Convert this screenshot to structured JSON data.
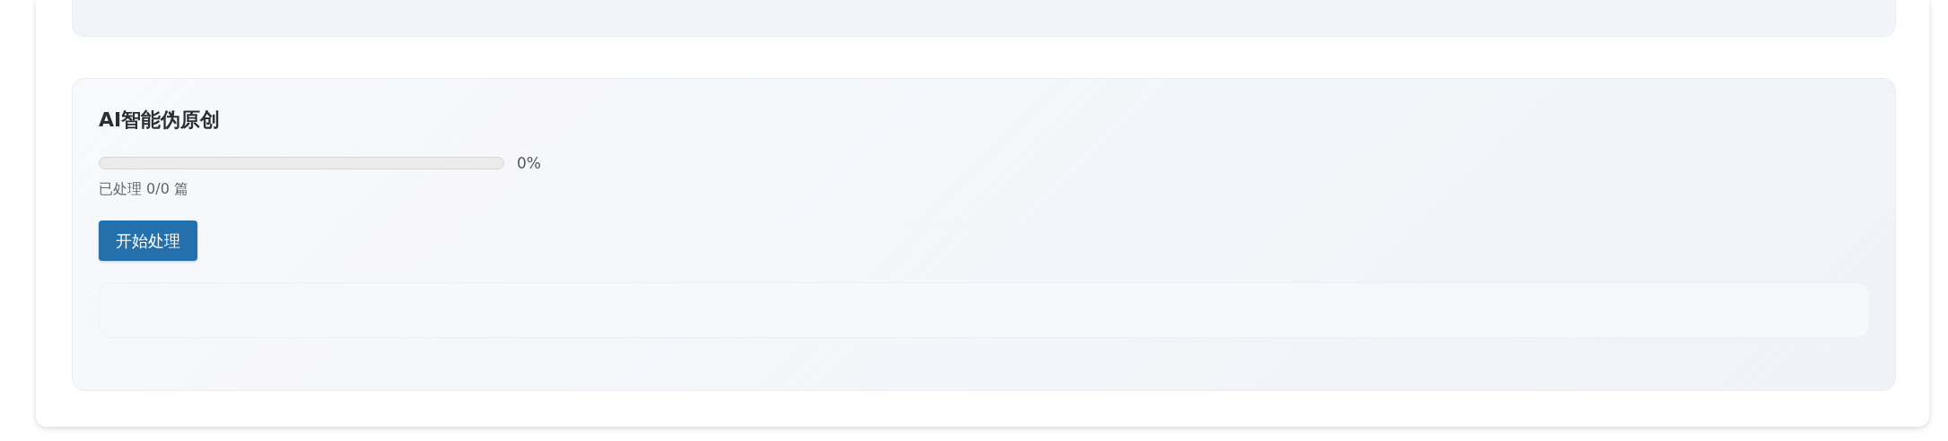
{
  "section": {
    "title": "AI智能伪原创",
    "progress": {
      "level": 0,
      "reading": "0%"
    },
    "status": "已处理 0/0 篇",
    "button": {
      "label": "开始处理"
    }
  }
}
